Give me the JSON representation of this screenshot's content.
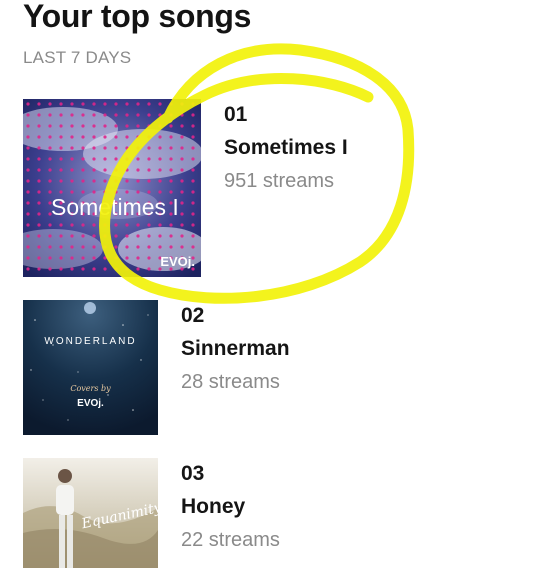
{
  "header": {
    "title": "Your top songs",
    "subtitle": "LAST 7 DAYS"
  },
  "songs": [
    {
      "rank": "01",
      "title": "Sometimes I",
      "streams": "951 streams",
      "art": {
        "title_text": "Sometimes I",
        "logo": "EVOj."
      }
    },
    {
      "rank": "02",
      "title": "Sinnerman",
      "streams": "28 streams",
      "art": {
        "title_text": "WONDERLAND",
        "covers_by": "Covers by",
        "logo": "EVOj."
      }
    },
    {
      "rank": "03",
      "title": "Honey",
      "streams": "22 streams",
      "art": {
        "title_text": "Equanimity"
      }
    }
  ],
  "colors": {
    "highlight": "#f2f20a",
    "muted_text": "#8a8a8a",
    "heading_text": "#141414"
  }
}
